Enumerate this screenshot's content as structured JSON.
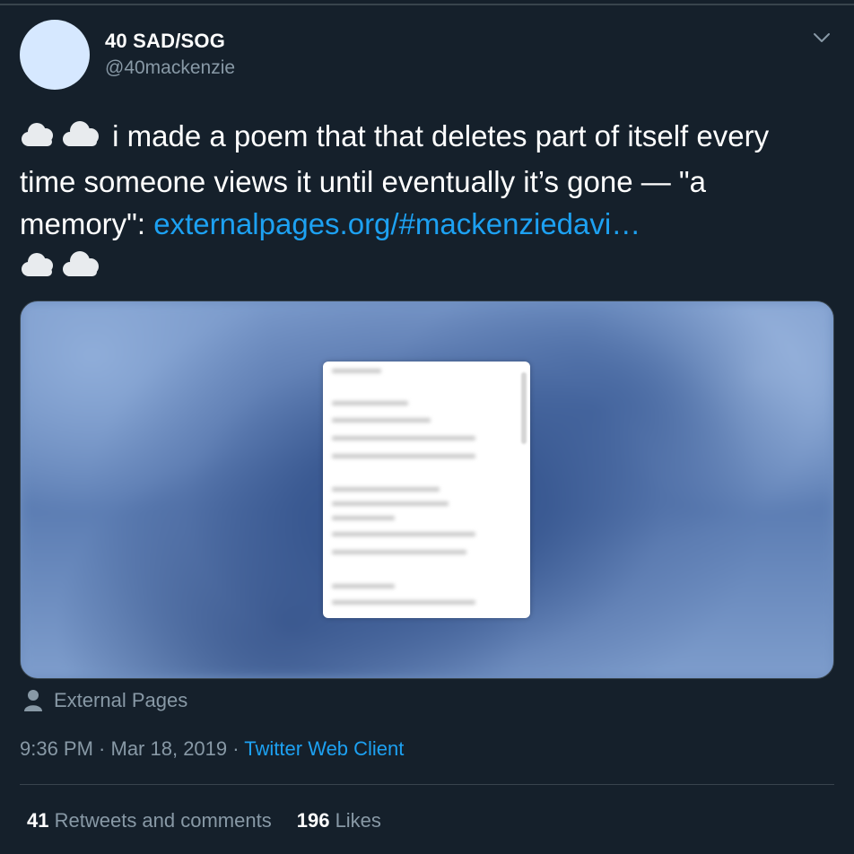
{
  "user": {
    "display_name": "40 SAD/SOG",
    "handle": "@40mackenzie"
  },
  "tweet": {
    "emoji_prefix": "cloud-emoji x2",
    "text_main": " i made a poem that that deletes part of itself every time someone views it until eventually it’s gone — \"a memory\": ",
    "link_text": "externalpages.org/#mackenziedavi…",
    "emoji_suffix": "cloud-emoji x2"
  },
  "card": {
    "source_name": "External Pages",
    "image_desc": "blurred-preview"
  },
  "meta": {
    "time": "9:36 PM",
    "dot1": " · ",
    "date": "Mar 18, 2019",
    "dot2": " · ",
    "client": "Twitter Web Client"
  },
  "stats": {
    "retweets_count": "41",
    "retweets_label": "Retweets and comments",
    "likes_count": "196",
    "likes_label": "Likes"
  },
  "icons": {
    "more": "chevron-down-icon",
    "source": "user-icon",
    "emoji": "cloud-icon"
  },
  "colors": {
    "background": "#15202b",
    "link": "#1da1f2",
    "secondary": "#8899a6",
    "divider": "#38444d"
  }
}
